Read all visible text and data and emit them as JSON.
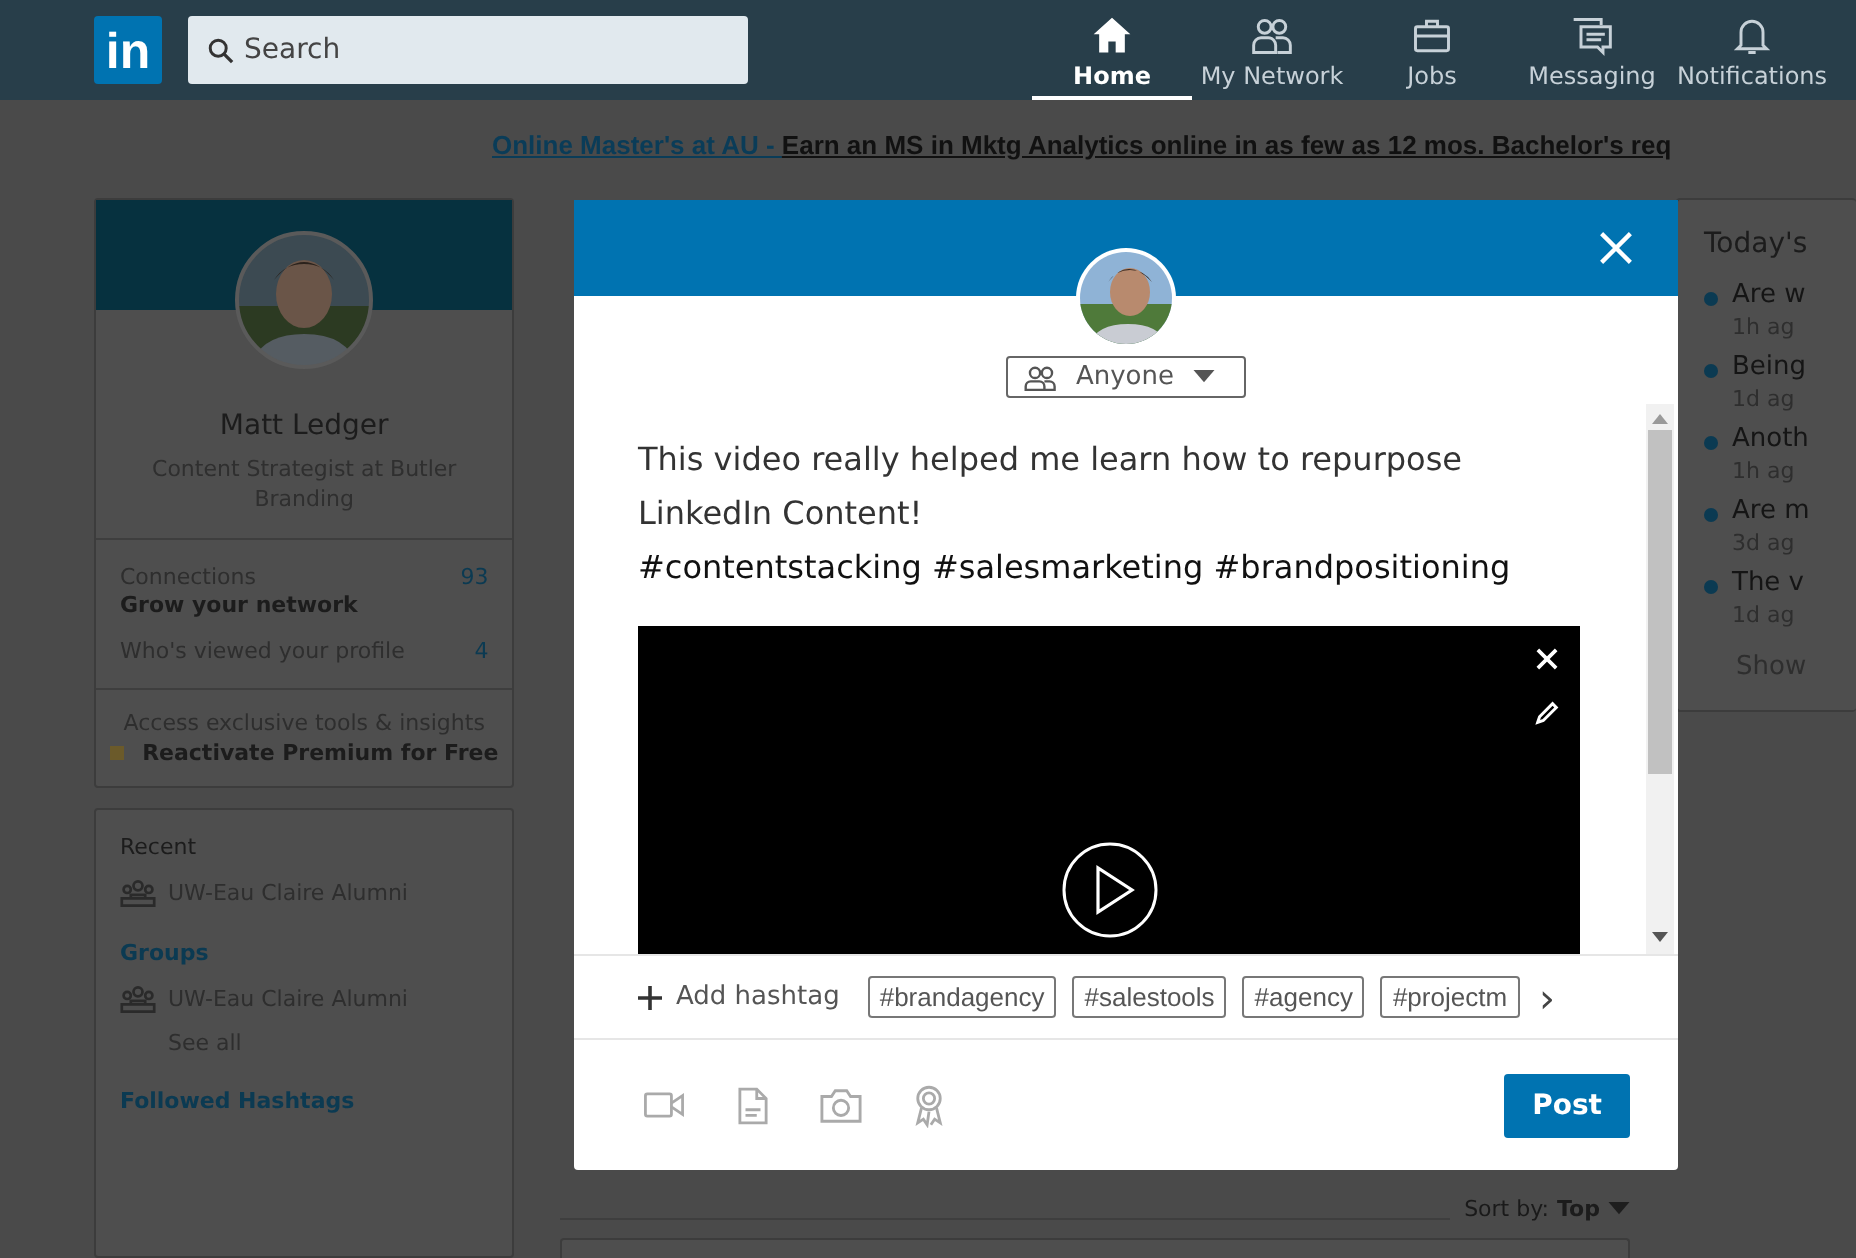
{
  "nav": {
    "logo": "in",
    "search": {
      "placeholder": "Search"
    },
    "items": [
      {
        "label": "Home",
        "kind": "home",
        "selected": true
      },
      {
        "label": "My Network",
        "kind": "network",
        "selected": false
      },
      {
        "label": "Jobs",
        "kind": "jobs",
        "selected": false
      },
      {
        "label": "Messaging",
        "kind": "messaging",
        "selected": false
      },
      {
        "label": "Notifications",
        "kind": "notifications",
        "selected": false
      }
    ]
  },
  "ad": {
    "link": "Online Master's at AU - ",
    "text": "Earn an MS in Mktg Analytics online in as few as 12 mos. Bachelor's req"
  },
  "profile": {
    "name": "Matt Ledger",
    "headline": "Content Strategist at Butler Branding",
    "stats": [
      {
        "label": "Connections",
        "sub": "Grow your network",
        "value": "93"
      },
      {
        "label": "Who's viewed your profile",
        "value": "4"
      }
    ],
    "premium": {
      "text": "Access exclusive tools & insights",
      "link": "Reactivate Premium for Free"
    }
  },
  "sidebar": {
    "sections": [
      {
        "title": "Recent",
        "kind": "plain",
        "items": [
          "UW-Eau Claire Alumni"
        ]
      },
      {
        "title": "Groups",
        "kind": "link",
        "items": [
          "UW-Eau Claire Alumni"
        ],
        "more": "See all"
      },
      {
        "title": "Followed Hashtags",
        "kind": "link"
      }
    ]
  },
  "feed": {
    "sort_label": "Sort by:",
    "sort_value": "Top"
  },
  "news": {
    "title": "Today's",
    "items": [
      {
        "headline": "Are w",
        "time": "1h ag"
      },
      {
        "headline": "Being",
        "time": "1d ag"
      },
      {
        "headline": "Anoth",
        "time": "1h ag"
      },
      {
        "headline": "Are m",
        "time": "3d ag"
      },
      {
        "headline": "The v",
        "time": "1d ag"
      }
    ],
    "more": "Show"
  },
  "composer": {
    "visibility": "Anyone",
    "lines": [
      "This video really helped me learn how to repurpose",
      "LinkedIn Content!",
      "#contentstacking #salesmarketing #brandpositioning"
    ],
    "add_hashtag": "Add hashtag",
    "suggested": [
      "#brandagency",
      "#salestools",
      "#agency",
      "#projectm"
    ],
    "more": "›",
    "post": "Post"
  }
}
